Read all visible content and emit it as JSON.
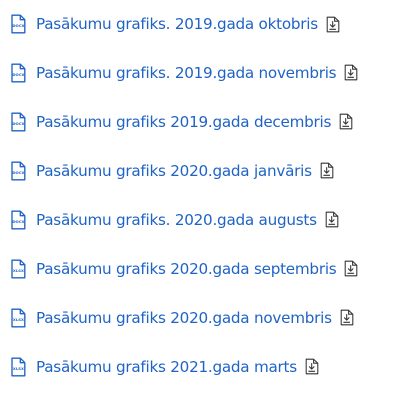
{
  "files": [
    {
      "title": "Pasākumu grafiks. 2019.gada oktobris",
      "type": "DOCX",
      "icon": "docx-file-icon"
    },
    {
      "title": "Pasākumu grafiks. 2019.gada novembris",
      "type": "DOCX",
      "icon": "docx-file-icon"
    },
    {
      "title": "Pasākumu grafiks 2019.gada decembris",
      "type": "DOCX",
      "icon": "docx-file-icon"
    },
    {
      "title": "Pasākumu grafiks 2020.gada janvāris",
      "type": "DOCX",
      "icon": "docx-file-icon"
    },
    {
      "title": "Pasākumu grafiks. 2020.gada augusts",
      "type": "DOCX",
      "icon": "docx-file-icon"
    },
    {
      "title": "Pasākumu grafiks 2020.gada septembris",
      "type": "XLSX",
      "icon": "xlsx-file-icon"
    },
    {
      "title": "Pasākumu grafiks 2020.gada novembris",
      "type": "XLSX",
      "icon": "xlsx-file-icon"
    },
    {
      "title": "Pasākumu grafiks 2021.gada marts",
      "type": "XLSX",
      "icon": "xlsx-file-icon"
    }
  ],
  "download_icon": "download-icon",
  "colors": {
    "link": "#1f63c6",
    "file_icon": "#1f63c6",
    "download_icon": "#333333",
    "background": "#ffffff"
  }
}
